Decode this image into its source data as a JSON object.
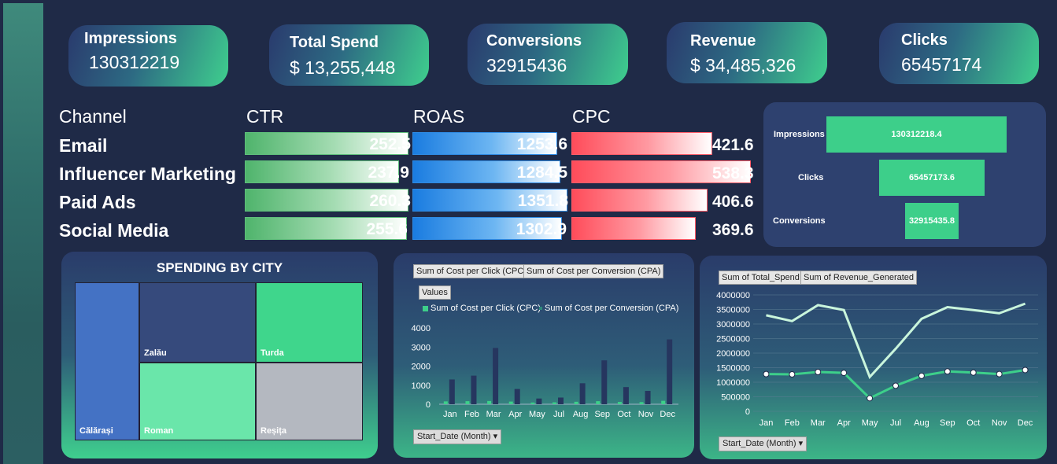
{
  "kpis": [
    {
      "label": "Impressions",
      "value": "130312219"
    },
    {
      "label": "Total Spend",
      "value": "$ 13,255,448"
    },
    {
      "label": "Conversions",
      "value": "32915436"
    },
    {
      "label": "Revenue",
      "value": "$ 34,485,326"
    },
    {
      "label": "Clicks",
      "value": "65457174"
    }
  ],
  "metrics_table": {
    "header_channel": "Channel",
    "header_ctr": "CTR",
    "header_roas": "ROAS",
    "header_cpc": "CPC",
    "rows": [
      {
        "channel": "Email",
        "ctr": "252.5",
        "roas": "1253.6",
        "cpc": "421.6"
      },
      {
        "channel": "Influencer Marketing",
        "ctr": "237.9",
        "roas": "1284.5",
        "cpc": "538.3"
      },
      {
        "channel": "Paid Ads",
        "ctr": "260.3",
        "roas": "1351.8",
        "cpc": "406.6"
      },
      {
        "channel": "Social Media",
        "ctr": "255.6",
        "roas": "1302.9",
        "cpc": "369.6"
      }
    ]
  },
  "colors": {
    "accent_green": "#3dcf8a",
    "ctr_bar": "#4fb46c",
    "roas_bar": "#1a7ce0",
    "cpc_bar": "#ff4c5a",
    "background": "#1f2a47"
  },
  "funnel": {
    "stages": [
      {
        "label": "Impressions",
        "value": "130312218.4"
      },
      {
        "label": "Clicks",
        "value": "65457173.6"
      },
      {
        "label": "Conversions",
        "value": "32915435.8"
      }
    ]
  },
  "city": {
    "title": "SPENDING BY CITY",
    "cells": [
      {
        "name": "Călărași",
        "color": "#4472c4"
      },
      {
        "name": "Zalău",
        "color": "#364a7c"
      },
      {
        "name": "Turda",
        "color": "#3fd68c"
      },
      {
        "name": "Roman",
        "color": "#6ae6aa"
      },
      {
        "name": "Reșița",
        "color": "#b4b8c0"
      }
    ]
  },
  "cpc_chart": {
    "field_buttons": [
      "Sum of Cost per Click (CPC)",
      "Sum of Cost per Conversion (CPA)"
    ],
    "values_button": "Values",
    "legend": [
      "Sum of Cost per Click (CPC)",
      "Sum of Cost per Conversion (CPA)"
    ],
    "filter": "Start_Date (Month)"
  },
  "rev_chart": {
    "field_buttons": [
      "Sum of Total_Spend",
      "Sum of Revenue_Generated"
    ],
    "filter": "Start_Date (Month)"
  },
  "chart_data": [
    {
      "type": "bar",
      "title": "",
      "categories": [
        "Jan",
        "Feb",
        "Mar",
        "Apr",
        "May",
        "Jul",
        "Aug",
        "Sep",
        "Oct",
        "Nov",
        "Dec"
      ],
      "series": [
        {
          "name": "Sum of Cost per Click (CPC)",
          "values": [
            150,
            160,
            170,
            140,
            90,
            100,
            130,
            160,
            120,
            110,
            180
          ]
        },
        {
          "name": "Sum of Cost per Conversion (CPA)",
          "values": [
            1300,
            1500,
            2950,
            800,
            300,
            350,
            1100,
            2300,
            900,
            700,
            3400
          ]
        }
      ],
      "yticks": [
        0,
        1000,
        2000,
        3000,
        4000
      ],
      "ylim": [
        0,
        4000
      ],
      "legend": "top"
    },
    {
      "type": "line",
      "title": "",
      "categories": [
        "Jan",
        "Feb",
        "Mar",
        "Apr",
        "May",
        "Jul",
        "Aug",
        "Sep",
        "Oct",
        "Nov",
        "Dec"
      ],
      "series": [
        {
          "name": "Sum of Total_Spend",
          "values": [
            1280000,
            1270000,
            1350000,
            1320000,
            450000,
            880000,
            1220000,
            1370000,
            1330000,
            1280000,
            1420000
          ]
        },
        {
          "name": "Sum of Revenue_Generated",
          "values": [
            3300000,
            3100000,
            3650000,
            3480000,
            1180000,
            2150000,
            3180000,
            3580000,
            3480000,
            3370000,
            3700000
          ]
        }
      ],
      "yticks": [
        0,
        500000,
        1000000,
        1500000,
        2000000,
        2500000,
        3000000,
        3500000,
        4000000
      ],
      "ylim": [
        0,
        4000000
      ],
      "grid": true
    }
  ]
}
